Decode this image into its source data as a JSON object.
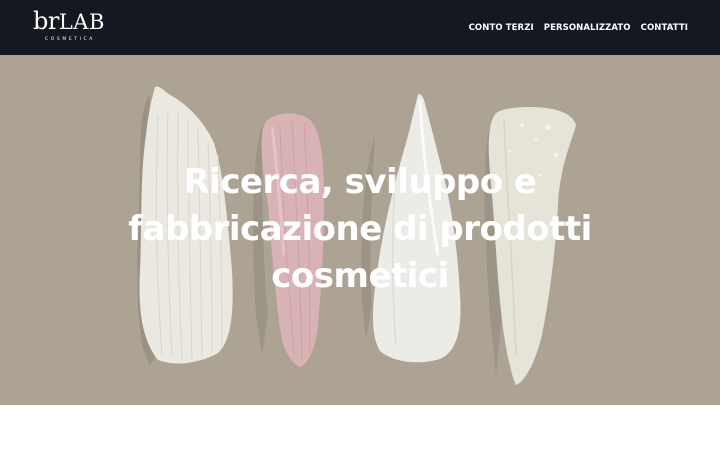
{
  "header": {
    "logo": {
      "main": "br",
      "lab": "LAB",
      "sub": "COSMETICA"
    },
    "nav": [
      "CONTO TERZI",
      "PERSONALIZZATO",
      "CONTATTI"
    ]
  },
  "hero": {
    "title": "Ricerca, sviluppo e fabbricazione di prodotti cosmetici",
    "background_image": "cosmetic cream swatches: white, pink, white, off-white"
  },
  "colors": {
    "header_bg": "#141820",
    "hero_bg": "#aca395",
    "text": "#ffffff"
  }
}
